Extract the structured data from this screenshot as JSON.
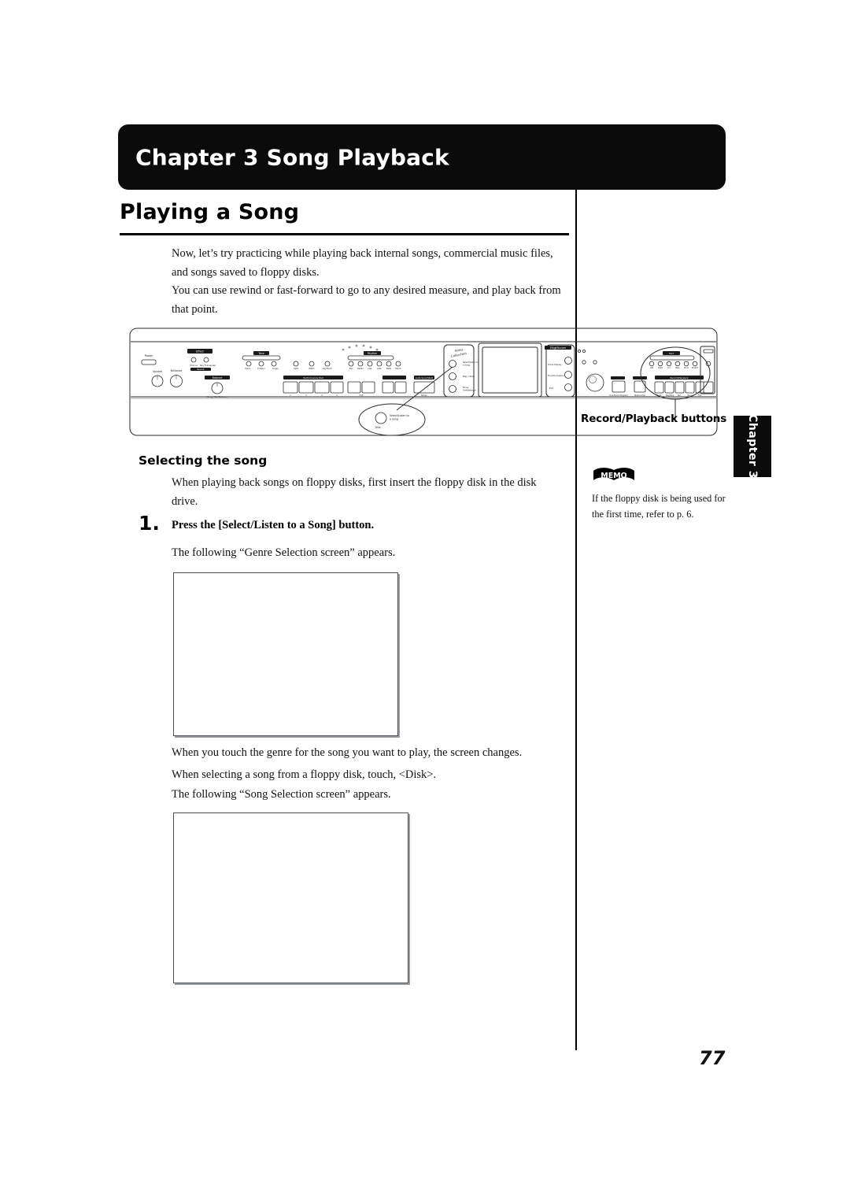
{
  "page": {
    "number": "77",
    "chapter_tab_label": "Chapter 3"
  },
  "header": {
    "chapter_title": "Chapter 3 Song Playback"
  },
  "main": {
    "title": "Playing a Song",
    "intro_paragraph_1": "Now, let’s try practicing while playing back internal songs, commercial music files, and songs saved to floppy disks.",
    "intro_paragraph_2": "You can use rewind or fast-forward to go to any desired measure, and play back from that point.",
    "section_heading": "Selecting the song",
    "section_intro": "When playing back songs on floppy disks, first insert the floppy disk in the disk drive.",
    "step_number": "1.",
    "step_title": "Press the [Select/Listen to a Song] button.",
    "step_follow_text": "The following “Genre Selection screen” appears.",
    "after_genre_text_1": "When you touch the genre for the song you want to play, the screen changes.",
    "after_genre_text_2": "When selecting a song from a floppy disk, touch, <Disk>.",
    "after_genre_text_3": "The following “Song Selection screen” appears."
  },
  "figure": {
    "callout_record_playback": "Record/Playback buttons",
    "callout_select_listen": "Select/Listen to a Song",
    "callout_disk": "Disk",
    "panel_labels": {
      "song_collection": "Song Collection",
      "digiscore": "DigiScore",
      "performance_pad": "Performance Pad",
      "record_playback_strip": "Record/Playback",
      "volume": "Volume",
      "display": "Display",
      "rhythm": "Rhythm",
      "tone": "Tone",
      "power": "Power"
    }
  },
  "memo": {
    "icon_label": "MEMO",
    "note": "If the floppy disk is being used for the first time, refer to p. 6."
  },
  "colors": {
    "ink": "#000000",
    "bar_black": "#0b0b0b",
    "box_border": "#4c4f55",
    "box_shadow": "#9b9ea3",
    "paper": "#ffffff"
  }
}
